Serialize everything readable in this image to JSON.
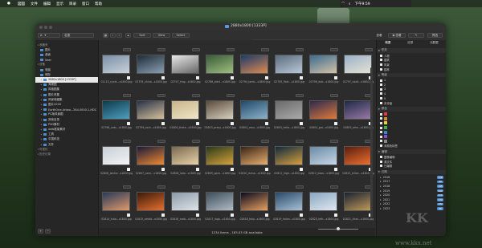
{
  "menubar": {
    "apple": "",
    "items": [
      "図図",
      "文件",
      "编辑",
      "显示",
      "目录",
      "窗口",
      "帮助"
    ],
    "clock": "下午9:59"
  },
  "window": {
    "title": "2880x1800 [1333P]",
    "sidebar_filter": "名童",
    "sidebar_sort": "A",
    "search_placeholder": "快速搜索",
    "toolbar_right": [
      "查看",
      "筛选"
    ],
    "nav_buttons": [
      "Sort",
      "View",
      "Select"
    ],
    "status": "1234 Items , 183.03 GB available"
  },
  "sidebar": {
    "rows": [
      {
        "label": "收藏夹",
        "type": "head"
      },
      {
        "label": "图片",
        "type": "fav"
      },
      {
        "label": "桌面",
        "type": "fav"
      },
      {
        "label": "Seer",
        "type": "fav"
      },
      {
        "label": "设备",
        "type": "head"
      },
      {
        "label": "电脑",
        "type": "fav"
      },
      {
        "label": "储存",
        "type": "fav"
      },
      {
        "label": "2880x1800 [1333P]",
        "type": "sel"
      },
      {
        "label": "海报图",
        "type": "tree"
      },
      {
        "label": "风格图集",
        "type": "tree"
      },
      {
        "label": "图片采集",
        "type": "tree"
      },
      {
        "label": "风景收藏集",
        "type": "tree"
      },
      {
        "label": "图片2018",
        "type": "tree"
      },
      {
        "label": "EarthOne.Artwo...264.0000.1-HDC",
        "type": "tree"
      },
      {
        "label": "PC版风景图",
        "type": "tree"
      },
      {
        "label": "其他目录",
        "type": "tree"
      },
      {
        "label": "PSD素材",
        "type": "tree"
      },
      {
        "label": "web框架素材",
        "type": "tree"
      },
      {
        "label": "工具",
        "type": "tree"
      },
      {
        "label": "中国科技",
        "type": "tree"
      },
      {
        "label": "文件",
        "type": "tree"
      },
      {
        "label": "可视化",
        "type": "head"
      },
      {
        "label": "历史记录",
        "type": "head"
      }
    ]
  },
  "thumbnails": {
    "captions": [
      "01115_cycle...x1800.jpg",
      "02735_china...x1800.jpg",
      "02797_frog...x1800.jpg",
      "02768_alert...x1800.jpg",
      "02794_lamb...x1800.jpg",
      "02795_flatc...x1800.jpg",
      "02796_dub...x1800.jpg",
      "02797_coolt...x1800.jpg",
      "02798_nats...x1800.jpg",
      "02799_rock...x1800.jpg",
      "02800_theta...x1800.jpg",
      "02803_presy...x1800.jpg",
      "02804_mou...x1800.jpg",
      "02803_hella...x1800.jpg",
      "02804_gra...x1800.jpg",
      "02805_whe...x1800.jpg",
      "02806_winter...x1800.jpg",
      "02807_cami...x1800.jpg",
      "02808_lada...x1800.jpg",
      "02809_sprin...x1800.jpg",
      "02810_mesa...x1800.jpg",
      "02811_high...x1800.jpg",
      "02812_beas...x1800.jpg",
      "02813_hillan...x1800.jpg",
      "02814_kuta...x1800.jpg",
      "02815_ambit...x1800.jpg",
      "02816_arab...x1800.jpg",
      "02817_lago...x1800.jpg",
      "02818_toky...x1800.jpg",
      "02819_halon...x1800.jpg",
      "02820_leth...x1800.jpg",
      "02821_chan...x1800.jpg"
    ],
    "colors": [
      [
        "#7a8fa6",
        "#c9d2da"
      ],
      [
        "#1e2a36",
        "#8aa0b4"
      ],
      [
        "#e8e8e8",
        "#666"
      ],
      [
        "#3a5a3a",
        "#9fbf7f"
      ],
      [
        "#1b3b6a",
        "#e08a50"
      ],
      [
        "#5b6c7c",
        "#b9c8d8"
      ],
      [
        "#3a6b8e",
        "#d4c2a8"
      ],
      [
        "#9ab1c7",
        "#e6e2d6"
      ],
      [
        "#0e3a4e",
        "#4f9fbf"
      ],
      [
        "#28324a",
        "#d6c09a"
      ],
      [
        "#c9b48a",
        "#f0e6c8"
      ],
      [
        "#5a4b3a",
        "#d8d0c0"
      ],
      [
        "#1f4a6a",
        "#8fb2c9"
      ],
      [
        "#6a6a6a",
        "#aaa"
      ],
      [
        "#2e2a4e",
        "#e07a3a"
      ],
      [
        "#1f2a44",
        "#9a7aa8"
      ],
      [
        "#c7cfd6",
        "#f4f4f4"
      ],
      [
        "#1a1a3a",
        "#f08a30"
      ],
      [
        "#7a6a52",
        "#e8d2a8"
      ],
      [
        "#2a3a1a",
        "#d6a23a"
      ],
      [
        "#3a2416",
        "#e8b070"
      ],
      [
        "#0f2a3e",
        "#d8a040"
      ],
      [
        "#6a8aa4",
        "#c8d8e6"
      ],
      [
        "#5a1e0e",
        "#f07030"
      ],
      [
        "#2a3a5a",
        "#e09a6a"
      ],
      [
        "#3a1a0a",
        "#e87030"
      ],
      [
        "#8a9aa8",
        "#dfe4e8"
      ],
      [
        "#3e4e5a",
        "#b0bcc6"
      ],
      [
        "#0a0a1e",
        "#e8a060"
      ],
      [
        "#2a4a6a",
        "#a8c0d4"
      ],
      [
        "#8aa6c0",
        "#e0e8f0"
      ],
      [
        "#1a2230",
        "#c09a5a"
      ]
    ]
  },
  "right_panel": {
    "tabs": [
      "概要",
      "目录",
      "元数据"
    ],
    "sections": [
      {
        "title": "任务",
        "rows": [
          "人物",
          "建筑",
          "风景",
          "园林"
        ]
      },
      {
        "title": "等级",
        "rows": [
          "1",
          "2",
          "3",
          "4",
          "5",
          "未评级"
        ]
      },
      {
        "title": "颜色",
        "rows": [
          "",
          "",
          "",
          "",
          "",
          "",
          "",
          "未颜色标签"
        ]
      },
      {
        "title": "编辑",
        "rows": [
          "图像编辑",
          "源文件",
          "已编辑"
        ]
      },
      {
        "title": "日期",
        "rows": [
          "2016",
          "2017",
          "2018",
          "2019",
          "2020",
          "2021",
          "2022",
          "2023"
        ]
      }
    ],
    "color_swatches": [
      "#e04040",
      "#e08a30",
      "#e8d040",
      "#40b040",
      "#4080e0",
      "#8a50c0",
      "#888888"
    ],
    "year_badges": [
      "118",
      "89",
      "145",
      "240",
      "210",
      "174",
      "132",
      "96"
    ]
  },
  "watermark": {
    "big": "KK",
    "site": "www.kkx.net"
  },
  "theme": {
    "accent": "#4f8fd0",
    "selected": "#e8e8e8"
  }
}
